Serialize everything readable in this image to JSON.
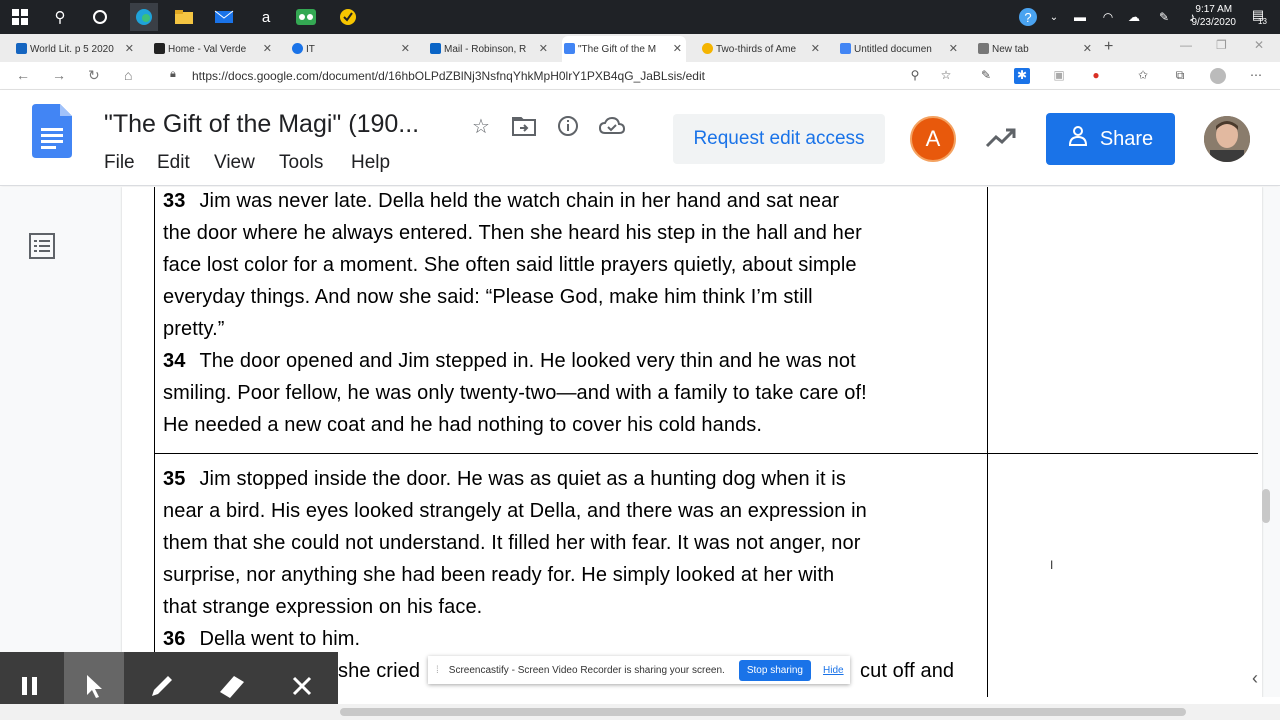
{
  "taskbar": {
    "time": "9:17 AM",
    "date": "9/23/2020",
    "notification_count": "13"
  },
  "tabs": [
    {
      "label": "World Lit. p 5 2020",
      "fav_color": "#1565c0"
    },
    {
      "label": "Home - Val Verde",
      "fav_color": "#222"
    },
    {
      "label": "IT",
      "fav_color": "#1a73e8"
    },
    {
      "label": "Mail - Robinson, R",
      "fav_color": "#0a64c6"
    },
    {
      "label": "\"The Gift of the M",
      "fav_color": "#4285f4"
    },
    {
      "label": "Two-thirds of Ame",
      "fav_color": "#f4b400"
    },
    {
      "label": "Untitled documen",
      "fav_color": "#4285f4"
    },
    {
      "label": "New tab",
      "fav_color": "#777"
    }
  ],
  "address": {
    "url": "https://docs.google.com/document/d/16hbOLPdZBlNj3NsfnqYhkMpH0lrY1PXB4qG_JaBLsis/edit"
  },
  "doc": {
    "title": "\"The Gift of the Magi\" (190...",
    "menu": [
      "File",
      "Edit",
      "View",
      "Tools",
      "Help"
    ],
    "request_label": "Request edit access",
    "avatar_letter": "A",
    "share_label": "Share"
  },
  "paragraphs": {
    "p33_num": "33",
    "p33_lines": [
      "Jim was never late. Della held the watch chain in her hand and sat near",
      "the door where he always entered. Then she heard his step in the hall and her",
      "face lost color for a moment. She often said little prayers quietly, about simple",
      "everyday things. And now she said: “Please God, make him think I’m still",
      "pretty.”"
    ],
    "p34_num": "34",
    "p34_lines": [
      "The door opened and Jim stepped in. He looked very thin and he was not",
      "smiling. Poor fellow, he was only twenty-two—and with a family to take care of!",
      "He needed a new coat and he had nothing to cover his cold hands."
    ],
    "p35_num": "35",
    "p35_lines": [
      "Jim stopped inside the door. He was as quiet as a hunting dog when it is",
      "near a bird. His eyes looked strangely at Della, and there was an expression in",
      "them that she could not understand. It filled her with fear. It was not anger, nor",
      "surprise, nor anything she had been ready for. He simply looked at her with",
      "that strange expression on his face."
    ],
    "p36_num": "36",
    "p36_line": "Della went to him.",
    "partial_left": "she cried",
    "partial_right": "cut off and"
  },
  "sharebar": {
    "message": "Screencastify - Screen Video Recorder is sharing your screen.",
    "stop_label": "Stop sharing",
    "hide_label": "Hide"
  }
}
